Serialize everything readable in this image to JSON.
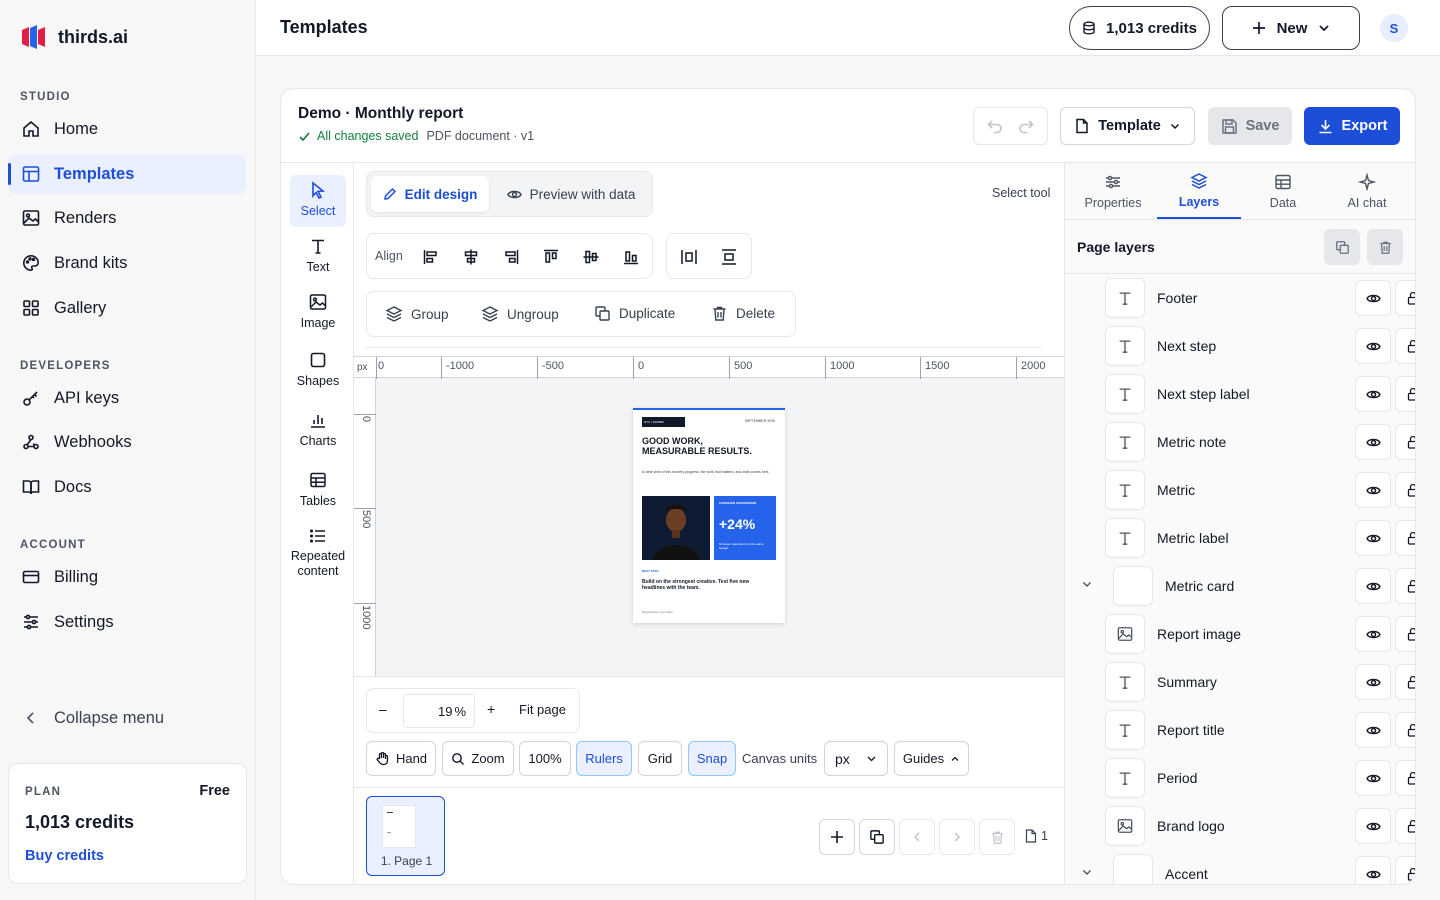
{
  "brand": {
    "name": "thirds.ai"
  },
  "sidebar": {
    "sections": {
      "studio": "STUDIO",
      "developers": "DEVELOPERS",
      "account": "ACCOUNT"
    },
    "items": {
      "home": "Home",
      "templates": "Templates",
      "renders": "Renders",
      "brand_kits": "Brand kits",
      "gallery": "Gallery",
      "api_keys": "API keys",
      "webhooks": "Webhooks",
      "docs": "Docs",
      "billing": "Billing",
      "settings": "Settings"
    },
    "collapse_label": "Collapse menu",
    "plan": {
      "label": "PLAN",
      "tier": "Free",
      "credits": "1,013 credits",
      "buy_label": "Buy credits"
    }
  },
  "topbar": {
    "title": "Templates",
    "credits_label": "1,013 credits",
    "new_label": "New",
    "avatar_initial": "S"
  },
  "editor": {
    "doc_title": "Demo · Monthly report",
    "saved_status": "All changes saved",
    "doc_meta": "PDF document · v1",
    "template_label": "Template",
    "save_label": "Save",
    "export_label": "Export",
    "tools": {
      "select": "Select",
      "text": "Text",
      "image": "Image",
      "shapes": "Shapes",
      "charts": "Charts",
      "tables": "Tables",
      "repeated_line1": "Repeated",
      "repeated_line2": "content"
    },
    "mode_tabs": {
      "edit": "Edit design",
      "preview": "Preview with data"
    },
    "active_tool_label": "Select tool",
    "align_label": "Align",
    "actions": {
      "group": "Group",
      "ungroup": "Ungroup",
      "duplicate": "Duplicate",
      "delete": "Delete"
    },
    "ruler": {
      "unit": "px",
      "h_ticks": [
        "0",
        "-1000",
        "-500",
        "0",
        "500",
        "1000",
        "1500",
        "2000"
      ],
      "v_ticks": [
        "0",
        "500",
        "1000"
      ]
    },
    "page_preview": {
      "badge": "NYC / DUMBO",
      "date": "SEPTEMBER 2026",
      "headline_line1": "GOOD WORK,",
      "headline_line2": "MEASURABLE RESULTS.",
      "summary": "A clear view of this month's progress, the work that matters, and what comes next.",
      "metric_card_label": "CAMPAIGN CONVERSION",
      "metric": "+24%",
      "metric_note": "Stronger response from the same budget.",
      "next_step_label": "NEXT STEP",
      "next_step": "Build on the strongest creative. Test five new headlines with the team.",
      "footer": "Prepared for your team"
    },
    "zoom": {
      "minus": "–",
      "value": "19",
      "unit": "%",
      "plus": "+",
      "fit_label": "Fit page"
    },
    "bottom_tools": {
      "hand": "Hand",
      "zoom": "Zoom",
      "hundred": "100%",
      "rulers": "Rulers",
      "grid": "Grid",
      "snap": "Snap",
      "canvas_units_label": "Canvas units",
      "units_value": "px",
      "guides": "Guides"
    },
    "pages": {
      "page1_label": "1. Page 1",
      "count": "1"
    }
  },
  "right_panel": {
    "tabs": {
      "properties": "Properties",
      "layers": "Layers",
      "data": "Data",
      "ai_chat": "AI chat"
    },
    "title": "Page layers",
    "layers": [
      {
        "name": "Footer",
        "icon": "text-icon"
      },
      {
        "name": "Next step",
        "icon": "text-icon"
      },
      {
        "name": "Next step label",
        "icon": "text-icon"
      },
      {
        "name": "Metric note",
        "icon": "text-icon"
      },
      {
        "name": "Metric",
        "icon": "text-icon"
      },
      {
        "name": "Metric label",
        "icon": "text-icon"
      },
      {
        "name": "Metric card",
        "icon": "box-icon"
      },
      {
        "name": "Report image",
        "icon": "image-icon"
      },
      {
        "name": "Summary",
        "icon": "text-icon"
      },
      {
        "name": "Report title",
        "icon": "text-icon"
      },
      {
        "name": "Period",
        "icon": "text-icon"
      },
      {
        "name": "Brand logo",
        "icon": "image-icon"
      },
      {
        "name": "Accent",
        "icon": "box-icon"
      }
    ]
  },
  "colors": {
    "accent": "#1d4ed8",
    "accent_bg": "#eaf0ff",
    "saved_green": "#15803d",
    "brand_red": "#e11d48",
    "brand_blue": "#2563eb"
  }
}
